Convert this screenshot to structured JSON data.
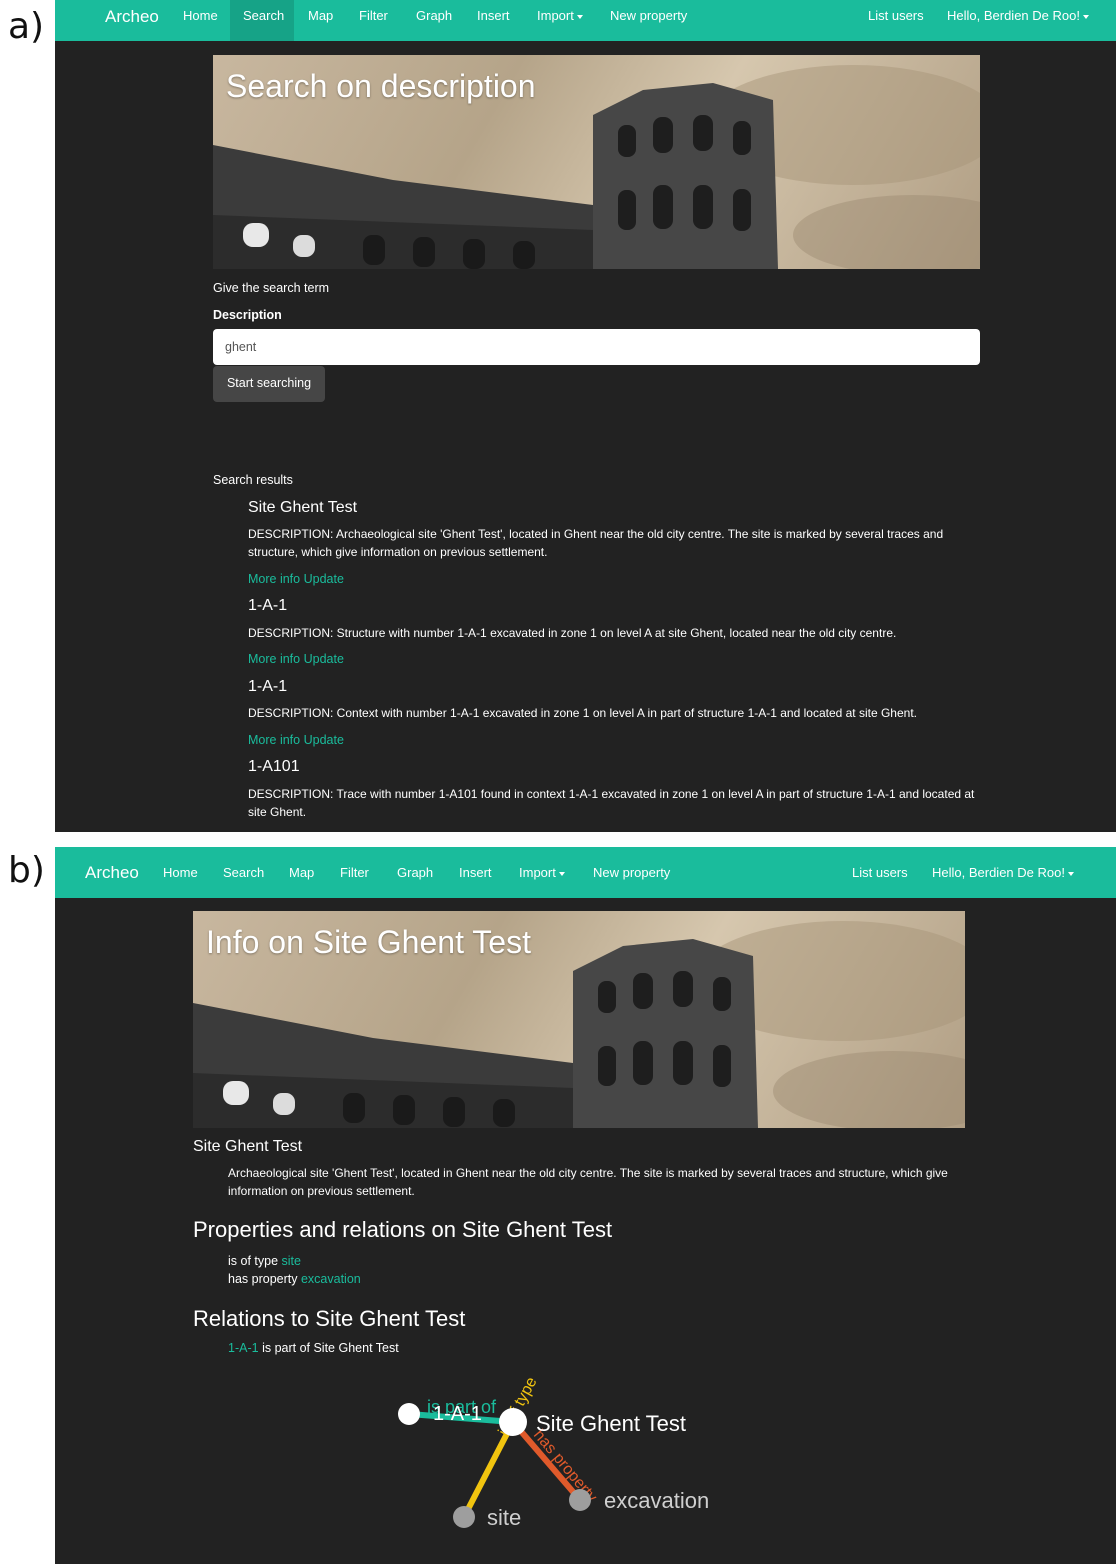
{
  "panels": [
    {
      "label": "a)",
      "nav": {
        "brand": "Archeo",
        "items": [
          "Home",
          "Search",
          "Map",
          "Filter",
          "Graph",
          "Insert",
          "Import",
          "New property"
        ],
        "active": "Search",
        "right": [
          "List users",
          "Hello, Berdien De Roo!"
        ]
      },
      "hero_title": "Search on description",
      "form": {
        "prompt": "Give the search term",
        "field_label": "Description",
        "input_value": "ghent",
        "button_label": "Start searching"
      },
      "results_heading": "Search results",
      "results": [
        {
          "title": "Site Ghent Test",
          "description": "DESCRIPTION: Archaeological site 'Ghent Test', located in Ghent near the old city centre. The site is marked by several traces and structure, which give information on previous settlement.",
          "more_info": "More info",
          "update": "Update"
        },
        {
          "title": "1-A-1",
          "description": "DESCRIPTION: Structure with number 1-A-1 excavated in zone 1 on level A at site Ghent, located near the old city centre.",
          "more_info": "More info",
          "update": "Update"
        },
        {
          "title": "1-A-1",
          "description": "DESCRIPTION: Context with number 1-A-1 excavated in zone 1 on level A in part of structure 1-A-1 and located at site Ghent.",
          "more_info": "More info",
          "update": "Update"
        },
        {
          "title": "1-A101",
          "description": "DESCRIPTION: Trace with number 1-A101 found in context 1-A-1 excavated in zone 1 on level A in part of structure 1-A-1 and located at site Ghent."
        }
      ]
    },
    {
      "label": "b)",
      "nav": {
        "brand": "Archeo",
        "items": [
          "Home",
          "Search",
          "Map",
          "Filter",
          "Graph",
          "Insert",
          "Import",
          "New property"
        ],
        "right": [
          "List users",
          "Hello, Berdien De Roo!"
        ]
      },
      "hero_title": "Info on Site Ghent Test",
      "entity_title": "Site Ghent Test",
      "entity_description": "Archaeological site 'Ghent Test', located in Ghent near the old city centre. The site is marked by several traces and structure, which give information on previous settlement.",
      "properties_heading": "Properties and relations on Site Ghent Test",
      "properties": [
        {
          "prefix": "is of type",
          "link": "site"
        },
        {
          "prefix": "has property",
          "link": "excavation"
        }
      ],
      "relations_heading": "Relations to Site Ghent Test",
      "relations": [
        {
          "link": "1-A-1",
          "suffix": "is part of Site Ghent Test"
        }
      ],
      "graph": {
        "nodes": [
          "1-A-1",
          "Site Ghent Test",
          "site",
          "excavation"
        ],
        "edges": [
          {
            "from": "1-A-1",
            "to": "Site Ghent Test",
            "label": "is part of",
            "color": "#1abc9c"
          },
          {
            "from": "Site Ghent Test",
            "to": "site",
            "label": "is of type",
            "color": "#f1c40f"
          },
          {
            "from": "Site Ghent Test",
            "to": "excavation",
            "label": "has property",
            "color": "#e05a2b"
          }
        ]
      }
    }
  ],
  "colors": {
    "accent": "#1abc9c",
    "page_bg": "#222222",
    "button_bg": "#464646",
    "edge_type": "#f1c40f",
    "edge_property": "#e05a2b",
    "node_main": "#ffffff",
    "node_leaf": "#9e9e9e"
  }
}
